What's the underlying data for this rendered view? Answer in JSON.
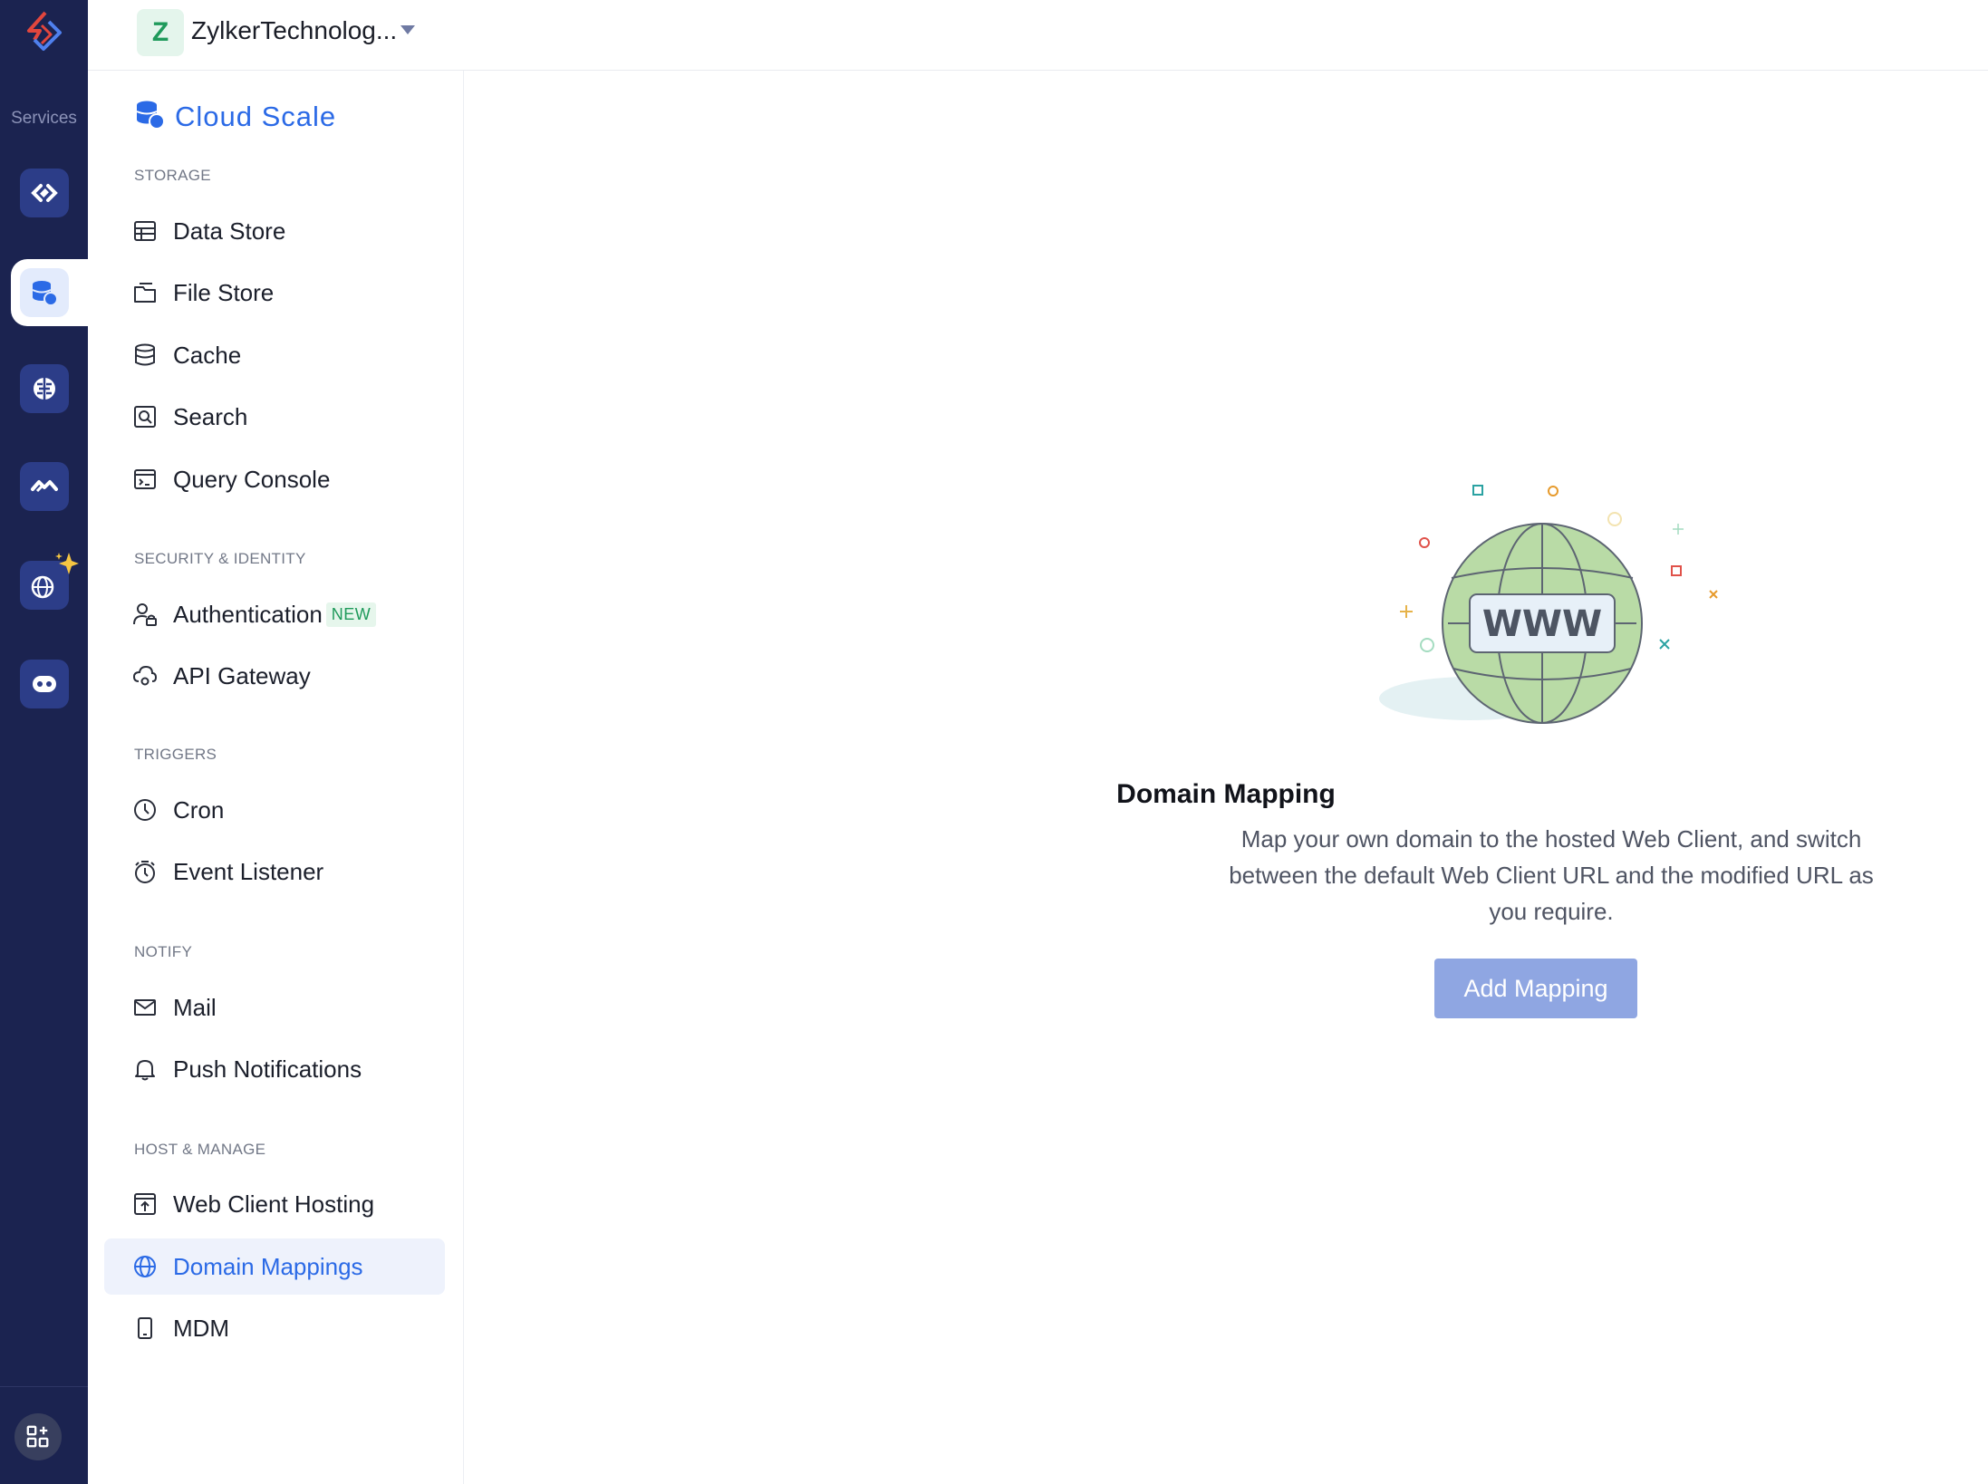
{
  "rail": {
    "services_label": "Services"
  },
  "header": {
    "org_initial": "Z",
    "org_name": "ZylkerTechnolog..."
  },
  "sidebar": {
    "title": "Cloud Scale",
    "sections": {
      "storage": "STORAGE",
      "security": "SECURITY & IDENTITY",
      "triggers": "TRIGGERS",
      "notify": "NOTIFY",
      "host": "HOST & MANAGE"
    },
    "items": {
      "data_store": "Data Store",
      "file_store": "File Store",
      "cache": "Cache",
      "search": "Search",
      "query_console": "Query Console",
      "authentication": "Authentication",
      "authentication_badge": "NEW",
      "api_gateway": "API Gateway",
      "cron": "Cron",
      "event_listener": "Event Listener",
      "mail": "Mail",
      "push_notifications": "Push Notifications",
      "web_client_hosting": "Web Client Hosting",
      "domain_mappings": "Domain Mappings",
      "mdm": "MDM"
    },
    "active_item": "Domain Mappings"
  },
  "main": {
    "illustration_text": "WWW",
    "title": "Domain Mapping",
    "description": "Map your own domain to the hosted Web Client, and switch between the default Web Client URL and the modified URL as you require.",
    "add_button": "Add Mapping"
  },
  "colors": {
    "rail_bg": "#1b2350",
    "accent": "#2b6ae6",
    "button_bg": "#8fa6e2",
    "badge_green": "#1f9a5b"
  }
}
